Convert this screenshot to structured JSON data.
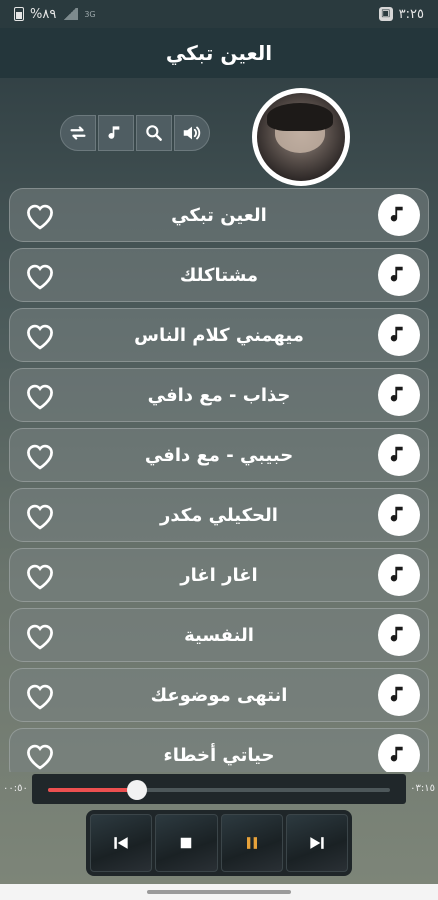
{
  "status_bar": {
    "time": "٣:٢٥",
    "battery_percent": "%٨٩",
    "network": "3G"
  },
  "app": {
    "title": "العين تبكي"
  },
  "controls": [
    {
      "name": "repeat-icon"
    },
    {
      "name": "music-note-icon"
    },
    {
      "name": "search-icon"
    },
    {
      "name": "volume-icon"
    }
  ],
  "songs": [
    {
      "title": "العين تبكي"
    },
    {
      "title": "مشتاكلك"
    },
    {
      "title": "ميهمني كلام الناس"
    },
    {
      "title": "جذاب - مع دافي"
    },
    {
      "title": "حبيبي - مع دافي"
    },
    {
      "title": "الحكيلي مكدر"
    },
    {
      "title": "اغار اغار"
    },
    {
      "title": "النفسية"
    },
    {
      "title": "انتهى موضوعك"
    },
    {
      "title": "حياتي أخطاء"
    }
  ],
  "player": {
    "elapsed": "٠٠:٥٠",
    "duration": "٠٣:١٥",
    "progress_fraction": 0.26,
    "buttons": [
      "previous-icon",
      "stop-icon",
      "pause-icon",
      "next-icon"
    ]
  },
  "colors": {
    "accent": "#ec5050",
    "pause": "#e8a23a"
  }
}
